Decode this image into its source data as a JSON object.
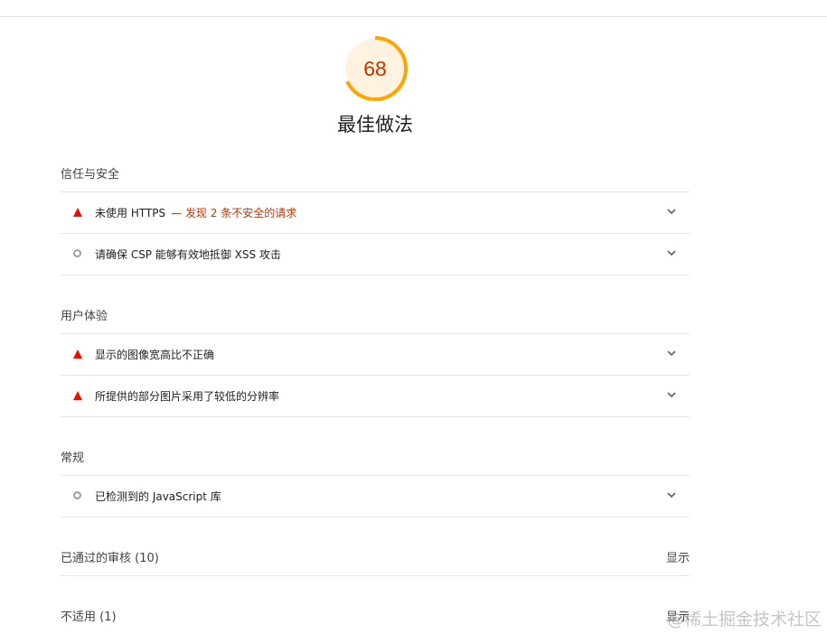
{
  "score": {
    "value": "68",
    "fraction": 0.68,
    "color": "#ffa400",
    "text_color": "#c33300",
    "track_color": "#fff3e0"
  },
  "category_title": "最佳做法",
  "groups": [
    {
      "title": "信任与安全",
      "audits": [
        {
          "icon": "fail-triangle-icon",
          "label": "未使用 HTTPS",
          "warning": "— 发现 2 条不安全的请求"
        },
        {
          "icon": "informative-circle-icon",
          "label": "请确保 CSP 能够有效地抵御 XSS 攻击",
          "warning": ""
        }
      ]
    },
    {
      "title": "用户体验",
      "audits": [
        {
          "icon": "fail-triangle-icon",
          "label": "显示的图像宽高比不正确",
          "warning": ""
        },
        {
          "icon": "fail-triangle-icon",
          "label": "所提供的部分图片采用了较低的分辨率",
          "warning": ""
        }
      ]
    },
    {
      "title": "常规",
      "audits": [
        {
          "icon": "informative-circle-icon",
          "label": "已检测到的 JavaScript 库",
          "warning": ""
        }
      ]
    }
  ],
  "passed": {
    "label": "已通过的审核",
    "count": "(10)",
    "button": "显示"
  },
  "not_applicable": {
    "label": "不适用",
    "count": "(1)",
    "button": "显示"
  },
  "watermark": "@稀土掘金技术社区",
  "colors": {
    "fail": "#eb0f00",
    "warning_text": "#c33300",
    "neutral_icon": "#9e9e9e"
  }
}
